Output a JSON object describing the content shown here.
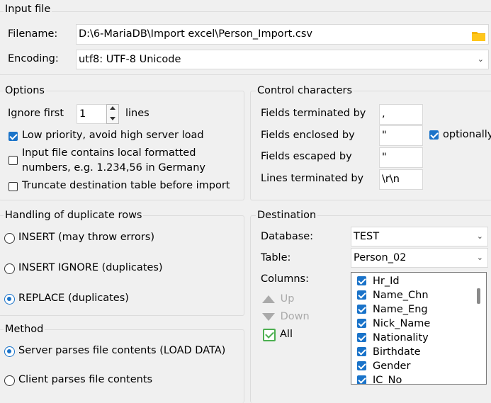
{
  "input_file": {
    "legend": "Input file",
    "filename_label": "Filename:",
    "filename_value": "D:\\6-MariaDB\\Import excel\\Person_Import.csv",
    "encoding_label": "Encoding:",
    "encoding_value": "utf8: UTF-8 Unicode"
  },
  "options": {
    "legend": "Options",
    "ignore_first_label": "Ignore first",
    "ignore_first_value": "1",
    "lines_label": "lines",
    "low_priority_label": "Low priority, avoid high server load",
    "low_priority_checked": true,
    "local_numbers_label_1": "Input file contains local formatted",
    "local_numbers_label_2": "numbers, e.g. 1.234,56 in Germany",
    "local_numbers_checked": false,
    "truncate_label": "Truncate destination table before import",
    "truncate_checked": false
  },
  "control_chars": {
    "legend": "Control characters",
    "fields_terminated_label": "Fields terminated by",
    "fields_terminated_value": ",",
    "fields_enclosed_label": "Fields enclosed by",
    "fields_enclosed_value": "\"",
    "optionally_label": "optionally",
    "optionally_checked": true,
    "fields_escaped_label": "Fields escaped by",
    "fields_escaped_value": "\"",
    "lines_terminated_label": "Lines terminated by",
    "lines_terminated_value": "\\r\\n"
  },
  "duplicates": {
    "legend": "Handling of duplicate rows",
    "insert_label": "INSERT (may throw errors)",
    "insert_ignore_label": "INSERT IGNORE (duplicates)",
    "replace_label": "REPLACE (duplicates)",
    "selected": "replace"
  },
  "method": {
    "legend": "Method",
    "server_label": "Server parses file contents (LOAD DATA)",
    "client_label": "Client parses file contents",
    "selected": "server"
  },
  "destination": {
    "legend": "Destination",
    "database_label": "Database:",
    "database_value": "TEST",
    "table_label": "Table:",
    "table_value": "Person_02",
    "columns_label": "Columns:",
    "up_label": "Up",
    "down_label": "Down",
    "all_label": "All",
    "all_checked": true,
    "columns": [
      "Hr_Id",
      "Name_Chn",
      "Name_Eng",
      "Nick_Name",
      "Nationality",
      "Birthdate",
      "Gender",
      "IC_No"
    ]
  },
  "colors": {
    "accent": "#1a73c9",
    "folder": "#f5b400",
    "all_check": "#4caf50"
  }
}
